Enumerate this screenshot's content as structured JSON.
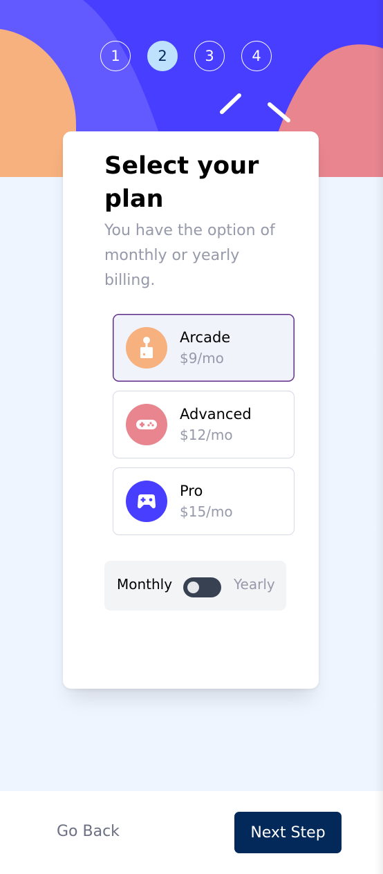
{
  "steps": [
    {
      "number": "1",
      "active": false
    },
    {
      "number": "2",
      "active": true
    },
    {
      "number": "3",
      "active": false
    },
    {
      "number": "4",
      "active": false
    }
  ],
  "card": {
    "title": "Select your plan",
    "subtitle": "You have the option of monthly or yearly billing."
  },
  "plans": [
    {
      "name": "Arcade",
      "price": "$9/mo",
      "icon": "arcade-joystick-icon",
      "color": "#ffaf7e",
      "selected": true
    },
    {
      "name": "Advanced",
      "price": "$12/mo",
      "icon": "gamepad-icon",
      "color": "#f9818e",
      "selected": false
    },
    {
      "name": "Pro",
      "price": "$15/mo",
      "icon": "controller-icon",
      "color": "#483eff",
      "selected": false
    }
  ],
  "billing": {
    "monthly_label": "Monthly",
    "yearly_label": "Yearly",
    "selected": "Monthly"
  },
  "footer": {
    "back_label": "Go Back",
    "next_label": "Next Step"
  },
  "colors": {
    "header_bg": "#483eff",
    "accent_orange": "#f6b17e",
    "accent_pink": "#e8858f",
    "primary_dark": "#022959",
    "page_bg": "#eff5ff"
  }
}
